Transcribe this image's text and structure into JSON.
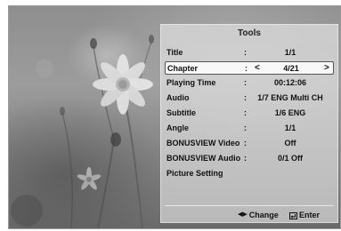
{
  "panel": {
    "title": "Tools",
    "rows": [
      {
        "label": "Title",
        "sep": ":",
        "value": "1/1"
      },
      {
        "label": "Chapter",
        "sep": ":",
        "value": "4/21",
        "left_arrow": "<",
        "right_arrow": ">"
      },
      {
        "label": "Playing Time",
        "sep": ":",
        "value": "00:12:06"
      },
      {
        "label": "Audio",
        "sep": ":",
        "value": "1/7 ENG Multi CH"
      },
      {
        "label": "Subtitle",
        "sep": ":",
        "value": "1/6 ENG"
      },
      {
        "label": "Angle",
        "sep": ":",
        "value": "1/1"
      },
      {
        "label": "BONUSVIEW Video",
        "sep": ":",
        "value": "Off"
      },
      {
        "label": "BONUSVIEW Audio",
        "sep": ":",
        "value": "0/1 Off"
      },
      {
        "label": "Picture Setting",
        "sep": "",
        "value": ""
      }
    ]
  },
  "footer": {
    "change_icon": "◀▶",
    "change_label": "Change",
    "enter_label": "Enter"
  },
  "icons": {
    "change": "left-right-arrows-icon",
    "enter": "enter-return-icon"
  }
}
